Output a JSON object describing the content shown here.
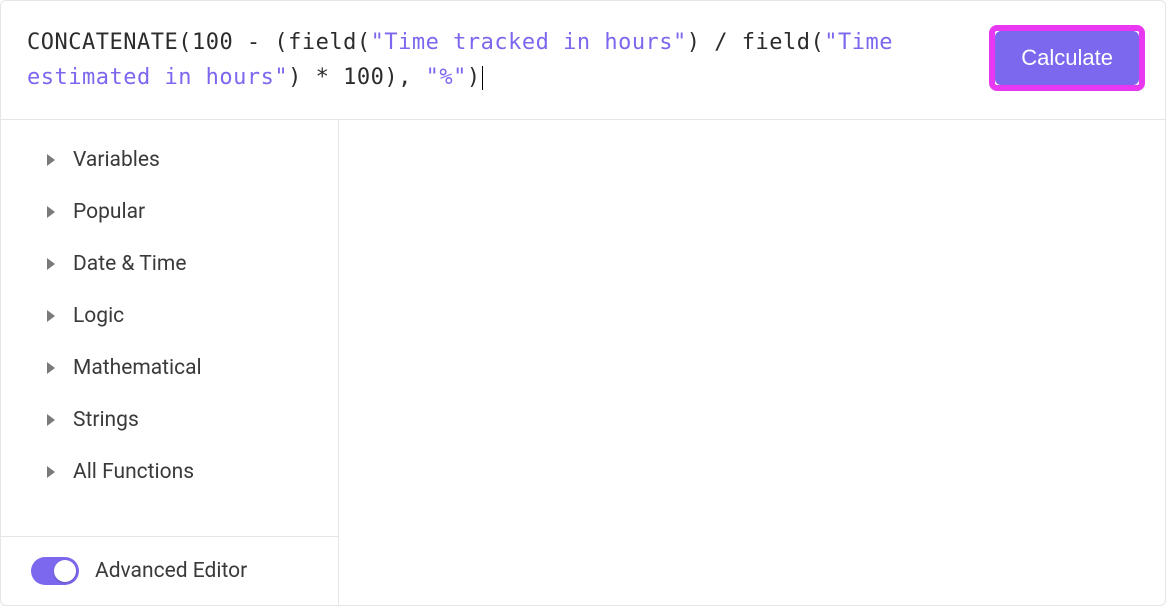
{
  "formula": {
    "tokens": [
      {
        "t": "fn",
        "v": "CONCATENATE"
      },
      {
        "t": "plain",
        "v": "(100 - ("
      },
      {
        "t": "fn",
        "v": "field"
      },
      {
        "t": "plain",
        "v": "("
      },
      {
        "t": "str",
        "v": "\"Time tracked in hours\""
      },
      {
        "t": "plain",
        "v": ") / "
      },
      {
        "t": "fn",
        "v": "field"
      },
      {
        "t": "plain",
        "v": "("
      },
      {
        "t": "str",
        "v": "\"Time estimated in hours\""
      },
      {
        "t": "plain",
        "v": ") * 100), "
      },
      {
        "t": "str",
        "v": "\"%\""
      },
      {
        "t": "plain",
        "v": ")"
      }
    ]
  },
  "calculate_label": "Calculate",
  "categories": [
    {
      "label": "Variables"
    },
    {
      "label": "Popular"
    },
    {
      "label": "Date & Time"
    },
    {
      "label": "Logic"
    },
    {
      "label": "Mathematical"
    },
    {
      "label": "Strings"
    },
    {
      "label": "All Functions"
    }
  ],
  "advanced_editor_label": "Advanced Editor",
  "advanced_editor_on": true
}
